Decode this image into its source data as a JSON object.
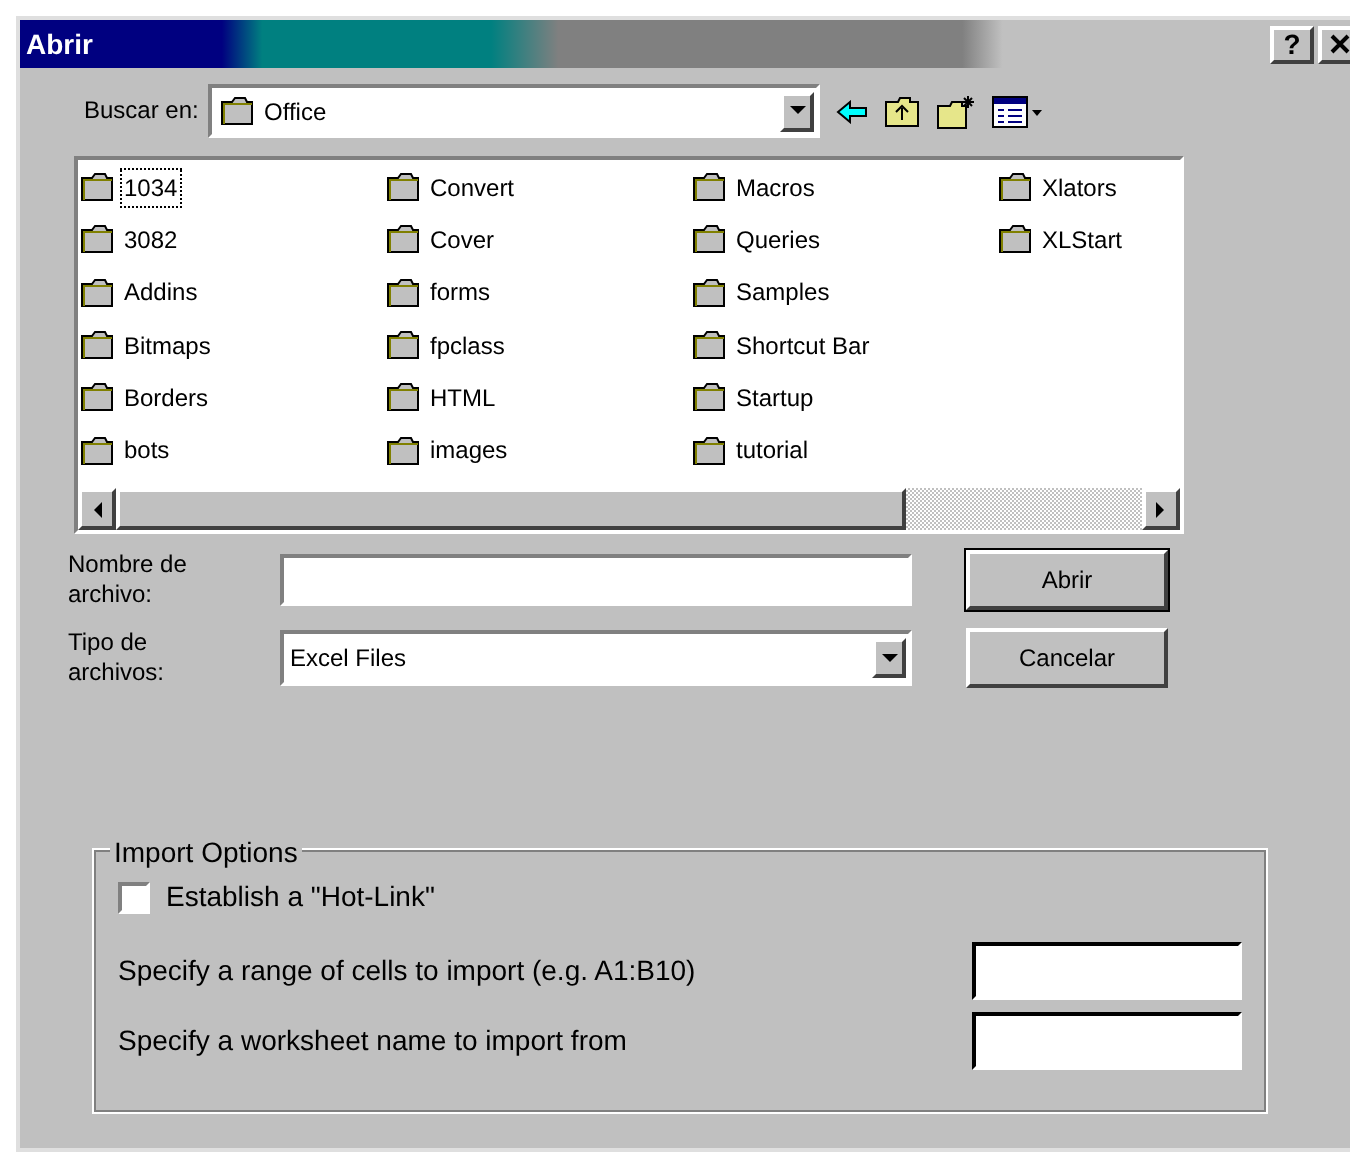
{
  "window": {
    "title": "Abrir",
    "help_button": "?"
  },
  "look_in": {
    "label": "Buscar en:",
    "value": "Office"
  },
  "files": [
    {
      "name": "1034",
      "selected": true
    },
    {
      "name": "3082",
      "selected": false
    },
    {
      "name": "Addins",
      "selected": false
    },
    {
      "name": "Bitmaps",
      "selected": false
    },
    {
      "name": "Borders",
      "selected": false
    },
    {
      "name": "bots",
      "selected": false
    },
    {
      "name": "Convert",
      "selected": false
    },
    {
      "name": "Cover",
      "selected": false
    },
    {
      "name": "forms",
      "selected": false
    },
    {
      "name": "fpclass",
      "selected": false
    },
    {
      "name": "HTML",
      "selected": false
    },
    {
      "name": "images",
      "selected": false
    },
    {
      "name": "Macros",
      "selected": false
    },
    {
      "name": "Queries",
      "selected": false
    },
    {
      "name": "Samples",
      "selected": false
    },
    {
      "name": "Shortcut Bar",
      "selected": false
    },
    {
      "name": "Startup",
      "selected": false
    },
    {
      "name": "tutorial",
      "selected": false
    },
    {
      "name": "Xlators",
      "selected": false
    },
    {
      "name": "XLStart",
      "selected": false
    }
  ],
  "file_name": {
    "label": "Nombre de archivo:"
  },
  "file_type": {
    "label": "Tipo de archivos:",
    "value": "Excel Files"
  },
  "buttons": [
    "Abrir",
    "Cancelar"
  ],
  "import_options": {
    "title": "Import Options",
    "hot_link": {
      "label": "Establish a \"Hot-Link\"",
      "checked": false
    },
    "fields": [
      {
        "label": "Specify a range of cells to import (e.g. A1:B10)"
      },
      {
        "label": "Specify a worksheet name to import from"
      }
    ]
  }
}
